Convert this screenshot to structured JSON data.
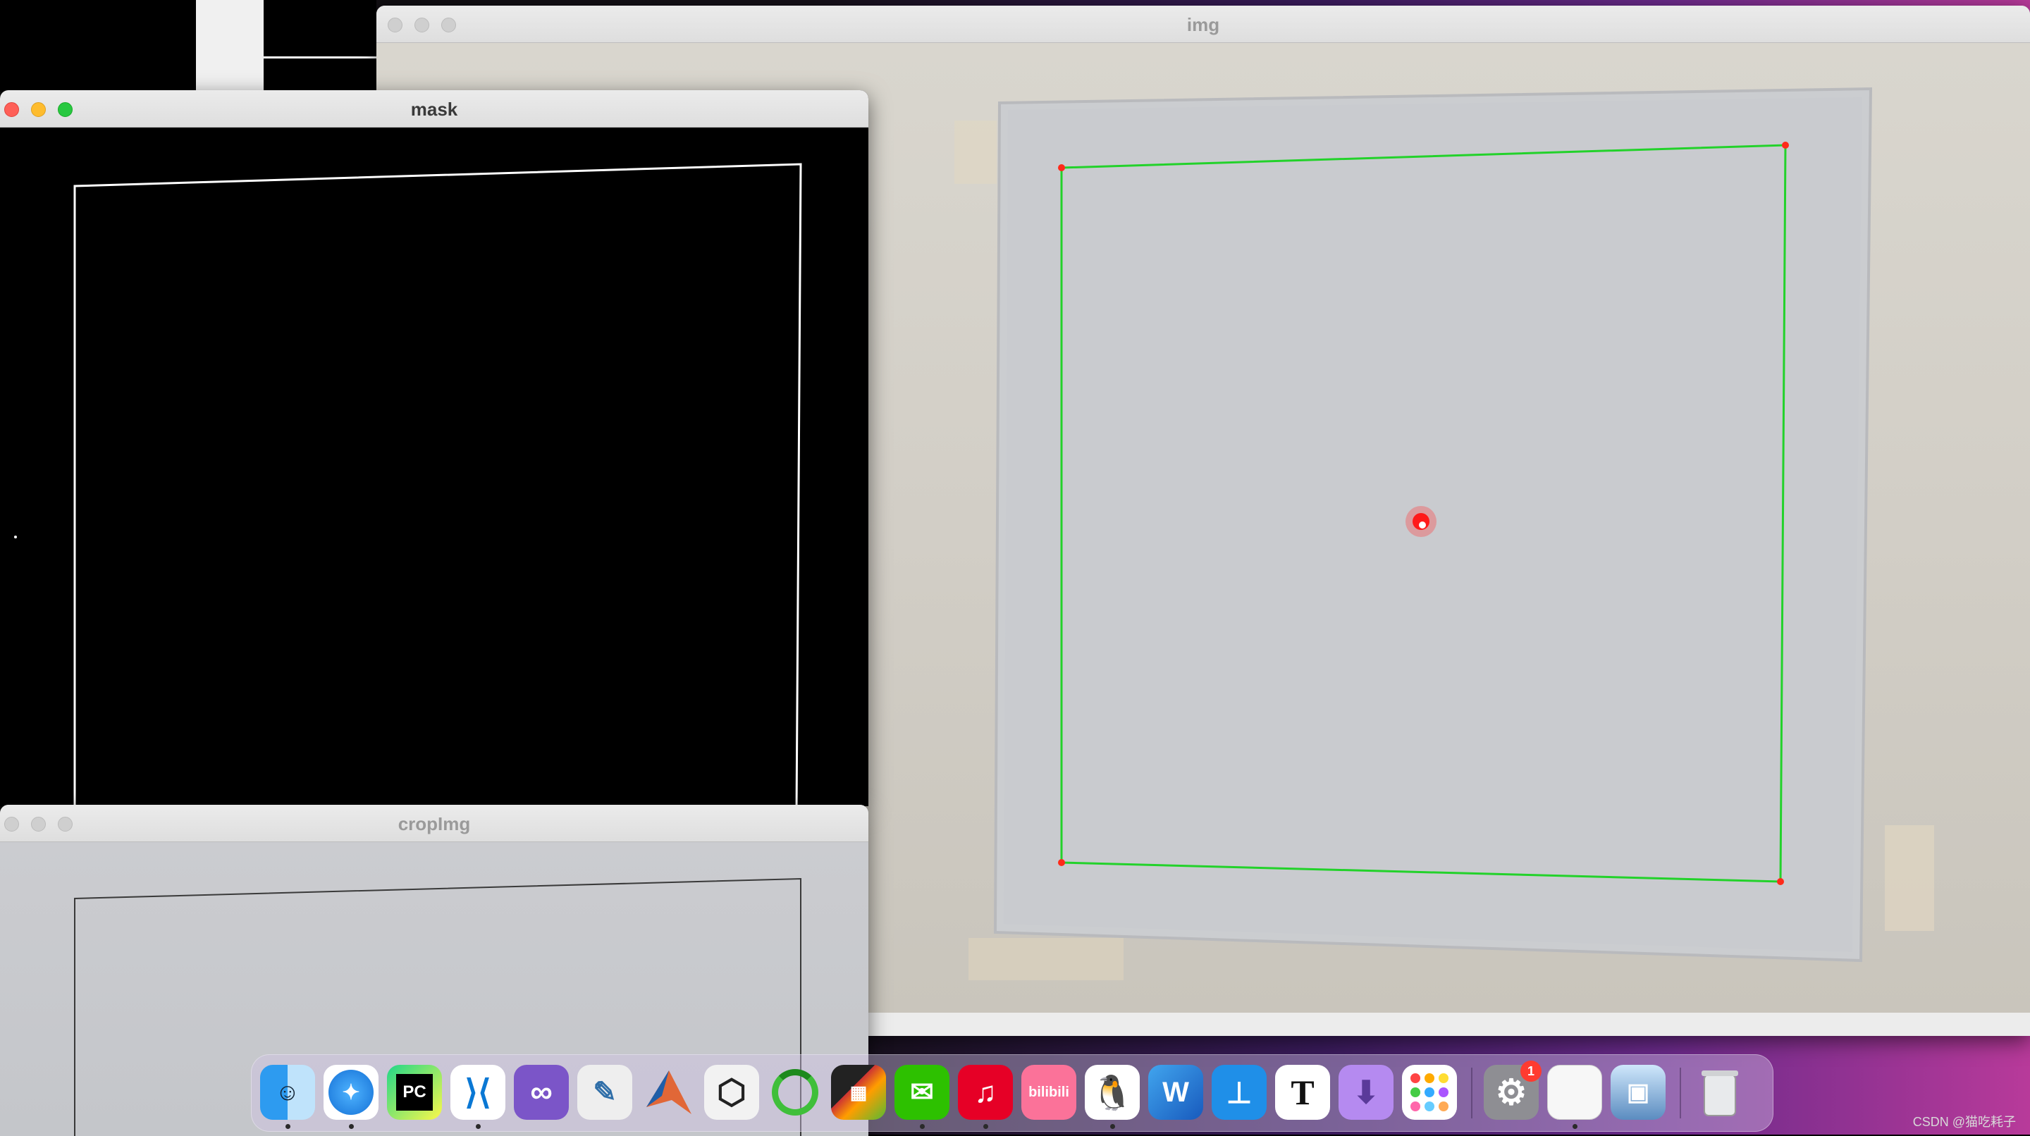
{
  "windows": {
    "img": {
      "title": "img"
    },
    "mask": {
      "title": "mask"
    },
    "cropimg": {
      "title": "cropImg"
    }
  },
  "dock": {
    "apps": [
      {
        "name": "finder",
        "icon": "finder-icon"
      },
      {
        "name": "safari",
        "icon": "compass-icon"
      },
      {
        "name": "pycharm",
        "icon": "pycharm-icon",
        "label": "PC"
      },
      {
        "name": "vscode",
        "icon": "vscode-icon"
      },
      {
        "name": "visual-studio",
        "icon": "visual-studio-icon"
      },
      {
        "name": "python-idle",
        "icon": "python-icon"
      },
      {
        "name": "matlab",
        "icon": "matlab-icon"
      },
      {
        "name": "unity",
        "icon": "unity-icon"
      },
      {
        "name": "loader",
        "icon": "ring-icon"
      },
      {
        "name": "final-cut",
        "icon": "clapper-icon"
      },
      {
        "name": "wechat",
        "icon": "wechat-icon"
      },
      {
        "name": "netease-music",
        "icon": "music-icon"
      },
      {
        "name": "bilibili",
        "icon": "bilibili-icon",
        "label": "bilibili"
      },
      {
        "name": "qq",
        "icon": "penguin-icon"
      },
      {
        "name": "word",
        "icon": "word-icon",
        "label": "W"
      },
      {
        "name": "keynote",
        "icon": "keynote-icon"
      },
      {
        "name": "typora",
        "icon": "typora-icon",
        "label": "T"
      },
      {
        "name": "downloads",
        "icon": "download-icon"
      },
      {
        "name": "launchpad",
        "icon": "launchpad-icon"
      },
      {
        "name": "system-settings",
        "icon": "gear-icon",
        "badge": "1"
      },
      {
        "name": "document",
        "icon": "document-icon"
      },
      {
        "name": "preview",
        "icon": "preview-icon"
      },
      {
        "name": "trash",
        "icon": "trash-icon"
      }
    ]
  },
  "watermark": "CSDN @猫吃耗子",
  "colors": {
    "detect_line": "#22d22a",
    "corner": "#ff2a1a",
    "laser": "#ff1a1a"
  }
}
